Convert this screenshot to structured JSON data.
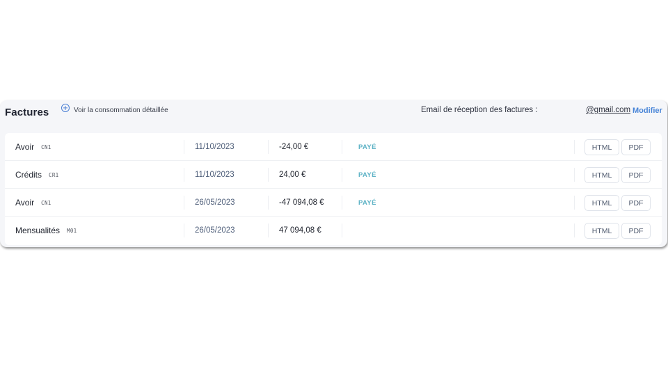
{
  "header": {
    "title": "Factures",
    "consumption_link": "Voir la consommation détaillée",
    "email_label": "Email de réception des factures :",
    "email_value": "@gmail.com",
    "modify_label": "Modifier"
  },
  "invoices": [
    {
      "type": "Avoir",
      "code": "CN1",
      "date": "11/10/2023",
      "amount": "-24,00 €",
      "status": "PAYÉ",
      "html_label": "HTML",
      "pdf_label": "PDF"
    },
    {
      "type": "Crédits",
      "code": "CR1",
      "date": "11/10/2023",
      "amount": "24,00 €",
      "status": "PAYÉ",
      "html_label": "HTML",
      "pdf_label": "PDF"
    },
    {
      "type": "Avoir",
      "code": "CN1",
      "date": "26/05/2023",
      "amount": "-47 094,08 €",
      "status": "PAYÉ",
      "html_label": "HTML",
      "pdf_label": "PDF"
    },
    {
      "type": "Mensualités",
      "code": "M01",
      "date": "26/05/2023",
      "amount": "47 094,08 €",
      "status": "",
      "html_label": "HTML",
      "pdf_label": "PDF"
    }
  ],
  "colors": {
    "accent": "#4a86d8",
    "status_paid": "#5fb3c6",
    "card_bg": "#f5f6f9"
  }
}
